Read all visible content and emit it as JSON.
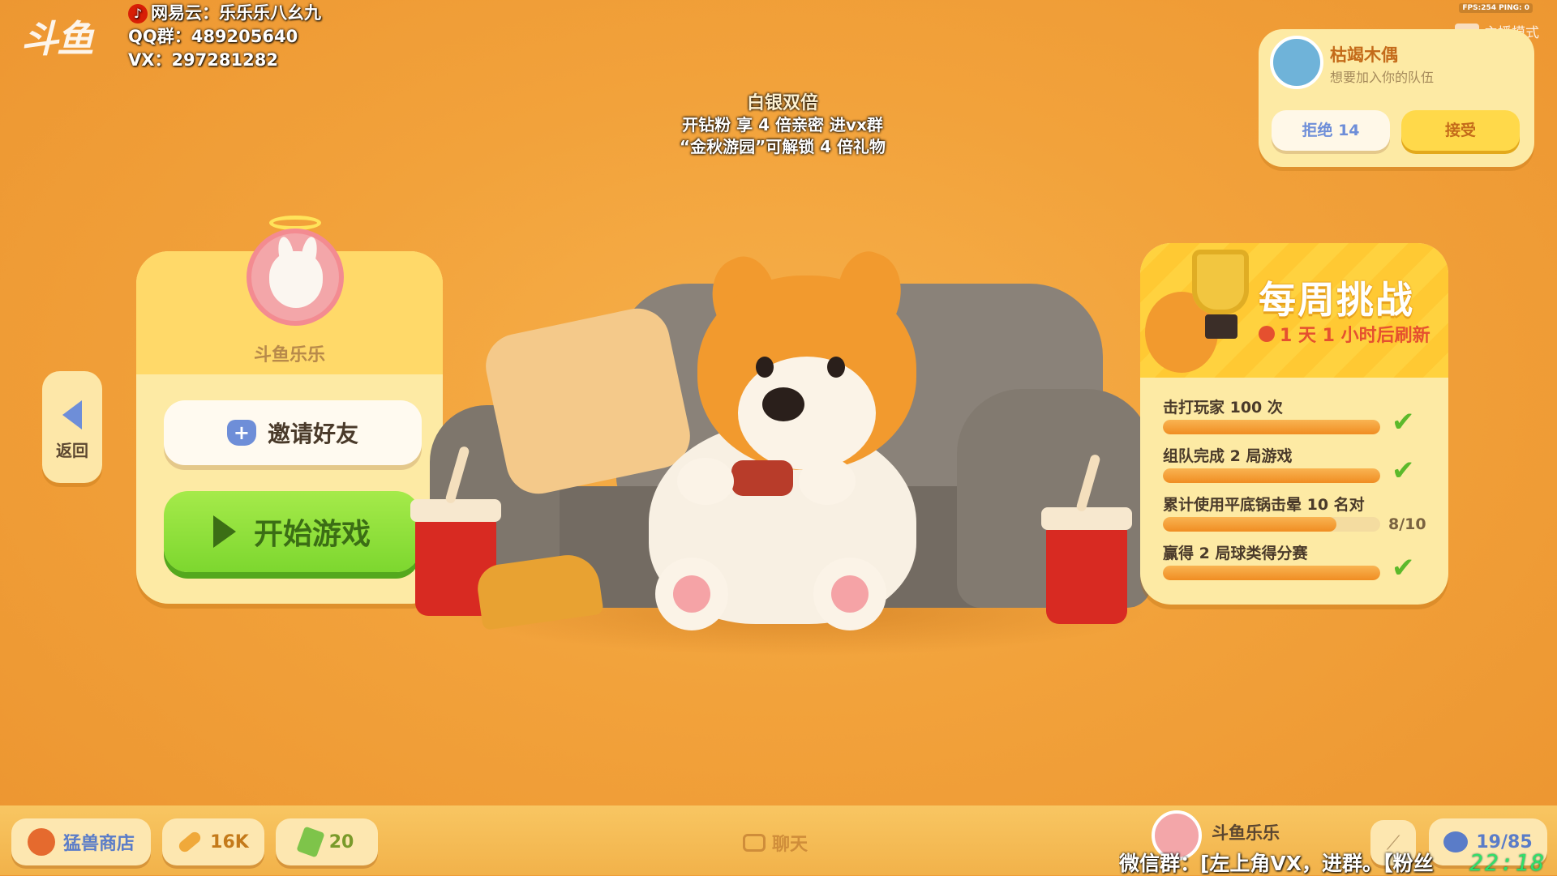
{
  "overlay": {
    "logo": "斗鱼",
    "stream_info": {
      "line1": "网易云：乐乐乐八幺九",
      "line2": "QQ群：489205640",
      "line3": "VX：297281282"
    },
    "promo": {
      "line0": "白银双倍",
      "line1": "开钻粉 享 4 倍亲密 进vx群",
      "line2": "“金秋游园”可解锁 4 倍礼物"
    },
    "fps_text": "FPS:254   PING: 0",
    "streamer_mode": "主播模式",
    "ticker": "微信群：[左上角VX，进群。【粉丝",
    "clock": "22:18"
  },
  "profile": {
    "name": "斗鱼乐乐",
    "invite_label": "邀请好友",
    "start_label": "开始游戏",
    "back_label": "返回"
  },
  "weekly_challenge": {
    "title": "每周挑战",
    "refresh": "1 天 1 小时后刷新",
    "tasks": [
      {
        "name": "击打玩家 100 次",
        "progress": 1.0,
        "complete": true
      },
      {
        "name": "组队完成 2 局游戏",
        "progress": 1.0,
        "complete": true
      },
      {
        "name": "累计使用平底锅击晕 10 名对",
        "progress": 0.8,
        "complete": false,
        "progress_text": "8/10"
      },
      {
        "name": "赢得 2 局球类得分赛",
        "progress": 1.0,
        "complete": true
      }
    ]
  },
  "team_invite": {
    "player": "枯竭木偶",
    "message": "想要加入你的队伍",
    "reject_label": "拒绝 14",
    "accept_label": "接受"
  },
  "bottom_bar": {
    "shop_label": "猛兽商店",
    "bones": "16K",
    "cash": "20",
    "chat_label": "聊天",
    "self_name": "斗鱼乐乐",
    "team_count": "19/85"
  },
  "colors": {
    "background": "#f2a23b",
    "panel": "#fdeaa4",
    "start_button": "#7dd72f",
    "accent_blue": "#6e8ed8",
    "check_green": "#5cb92b"
  }
}
